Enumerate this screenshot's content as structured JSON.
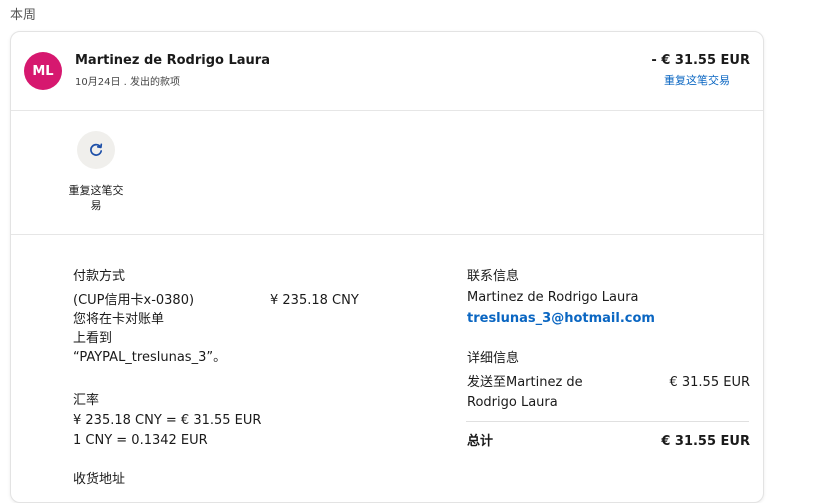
{
  "week_label": "本周",
  "transaction": {
    "avatar_initials": "ML",
    "avatar_color": "#d6186f",
    "name": "Martinez de Rodrigo Laura",
    "subtitle": "10月24日 . 发出的款项",
    "amount": "- € 31.55 EUR",
    "repeat_link": "重复这笔交易"
  },
  "actions": {
    "repeat_icon": "refresh-icon",
    "repeat_label_line1": "重复这笔交",
    "repeat_label_line2": "易"
  },
  "payment": {
    "title": "付款方式",
    "method_line1": "(CUP信用卡x-0380)",
    "method_line2": "您将在卡对账单",
    "method_line3": "上看到",
    "method_line4": "“PAYPAL_treslunas_3”。",
    "method_amount": "¥ 235.18 CNY"
  },
  "exchange": {
    "title": "汇率",
    "line1": "¥ 235.18 CNY = € 31.55 EUR",
    "line2": "1 CNY = 0.1342 EUR"
  },
  "shipping": {
    "title": "收货地址"
  },
  "contact": {
    "title": "联系信息",
    "name": "Martinez de Rodrigo Laura",
    "email": "treslunas_3@hotmail.com"
  },
  "detail": {
    "title": "详细信息",
    "sent_to_line1": "发送至Martinez de",
    "sent_to_line2": "Rodrigo Laura",
    "sent_amount": "€ 31.55 EUR",
    "total_label": "总计",
    "total_amount": "€ 31.55 EUR"
  }
}
